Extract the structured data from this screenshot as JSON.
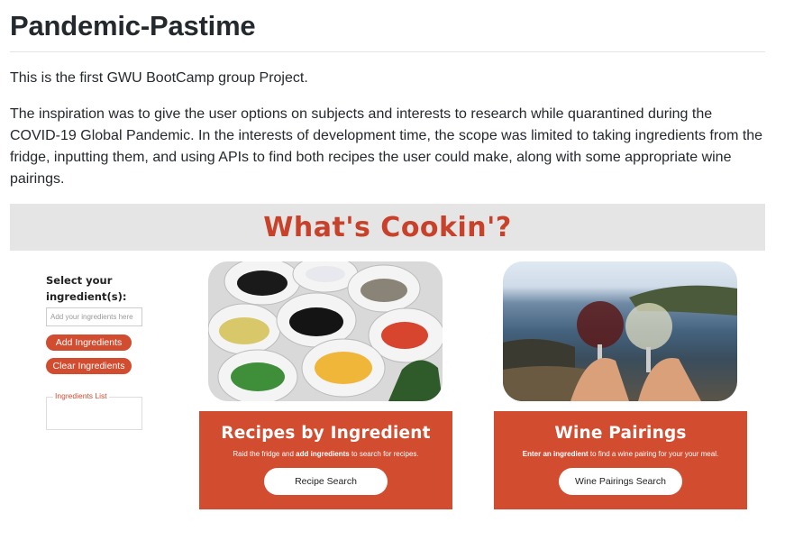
{
  "readme": {
    "title": "Pandemic-Pastime",
    "intro": "This is the first GWU BootCamp group Project.",
    "description": "The inspiration was to give the user options on subjects and interests to research while quarantined during the COVID-19 Global Pandemic. In the interests of development time, the scope was limited to taking ingredients from the fridge, inputting them, and using APIs to find both recipes the user could make, along with some appropriate wine pairings."
  },
  "app": {
    "title": "What's Cookin'?",
    "select_label": "Select your ingredient(s):",
    "input_placeholder": "Add your ingredients here",
    "add_button": "Add Ingredients",
    "clear_button": "Clear Ingredients",
    "ingredients_list_label": "Ingredients List",
    "recipes_card": {
      "title": "Recipes by Ingredient",
      "desc_before": "Raid the fridge and ",
      "desc_bold": "add ingredients",
      "desc_after": " to search for recipes.",
      "button": "Recipe Search"
    },
    "wine_card": {
      "title": "Wine Pairings",
      "desc_bold": "Enter an ingredient",
      "desc_after": " to find a wine pairing for your your meal.",
      "button": "Wine Pairings Search"
    },
    "accent_color": "#d24c30"
  }
}
